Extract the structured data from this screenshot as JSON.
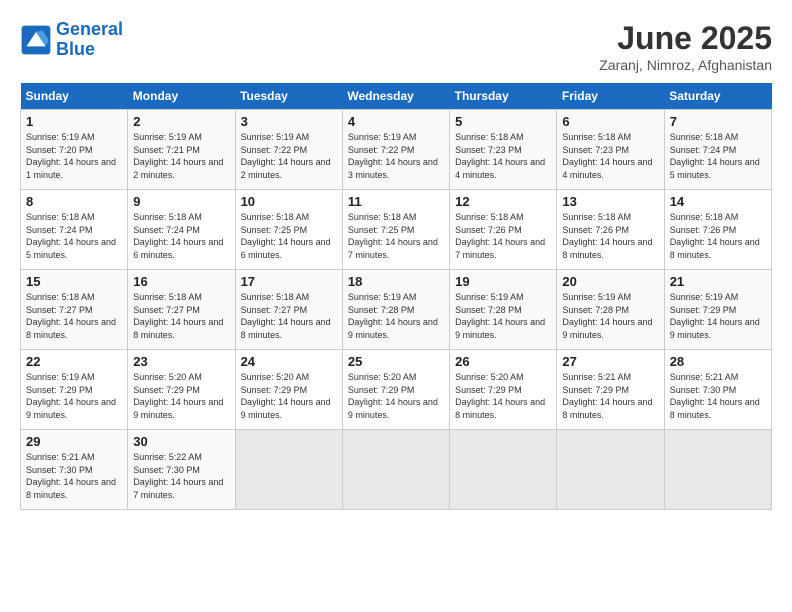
{
  "header": {
    "logo_line1": "General",
    "logo_line2": "Blue",
    "month": "June 2025",
    "location": "Zaranj, Nimroz, Afghanistan"
  },
  "weekdays": [
    "Sunday",
    "Monday",
    "Tuesday",
    "Wednesday",
    "Thursday",
    "Friday",
    "Saturday"
  ],
  "weeks": [
    [
      {
        "day": 1,
        "sunrise": "5:19 AM",
        "sunset": "7:20 PM",
        "daylight": "14 hours and 1 minute."
      },
      {
        "day": 2,
        "sunrise": "5:19 AM",
        "sunset": "7:21 PM",
        "daylight": "14 hours and 2 minutes."
      },
      {
        "day": 3,
        "sunrise": "5:19 AM",
        "sunset": "7:22 PM",
        "daylight": "14 hours and 2 minutes."
      },
      {
        "day": 4,
        "sunrise": "5:19 AM",
        "sunset": "7:22 PM",
        "daylight": "14 hours and 3 minutes."
      },
      {
        "day": 5,
        "sunrise": "5:18 AM",
        "sunset": "7:23 PM",
        "daylight": "14 hours and 4 minutes."
      },
      {
        "day": 6,
        "sunrise": "5:18 AM",
        "sunset": "7:23 PM",
        "daylight": "14 hours and 4 minutes."
      },
      {
        "day": 7,
        "sunrise": "5:18 AM",
        "sunset": "7:24 PM",
        "daylight": "14 hours and 5 minutes."
      }
    ],
    [
      {
        "day": 8,
        "sunrise": "5:18 AM",
        "sunset": "7:24 PM",
        "daylight": "14 hours and 5 minutes."
      },
      {
        "day": 9,
        "sunrise": "5:18 AM",
        "sunset": "7:24 PM",
        "daylight": "14 hours and 6 minutes."
      },
      {
        "day": 10,
        "sunrise": "5:18 AM",
        "sunset": "7:25 PM",
        "daylight": "14 hours and 6 minutes."
      },
      {
        "day": 11,
        "sunrise": "5:18 AM",
        "sunset": "7:25 PM",
        "daylight": "14 hours and 7 minutes."
      },
      {
        "day": 12,
        "sunrise": "5:18 AM",
        "sunset": "7:26 PM",
        "daylight": "14 hours and 7 minutes."
      },
      {
        "day": 13,
        "sunrise": "5:18 AM",
        "sunset": "7:26 PM",
        "daylight": "14 hours and 8 minutes."
      },
      {
        "day": 14,
        "sunrise": "5:18 AM",
        "sunset": "7:26 PM",
        "daylight": "14 hours and 8 minutes."
      }
    ],
    [
      {
        "day": 15,
        "sunrise": "5:18 AM",
        "sunset": "7:27 PM",
        "daylight": "14 hours and 8 minutes."
      },
      {
        "day": 16,
        "sunrise": "5:18 AM",
        "sunset": "7:27 PM",
        "daylight": "14 hours and 8 minutes."
      },
      {
        "day": 17,
        "sunrise": "5:18 AM",
        "sunset": "7:27 PM",
        "daylight": "14 hours and 8 minutes."
      },
      {
        "day": 18,
        "sunrise": "5:19 AM",
        "sunset": "7:28 PM",
        "daylight": "14 hours and 9 minutes."
      },
      {
        "day": 19,
        "sunrise": "5:19 AM",
        "sunset": "7:28 PM",
        "daylight": "14 hours and 9 minutes."
      },
      {
        "day": 20,
        "sunrise": "5:19 AM",
        "sunset": "7:28 PM",
        "daylight": "14 hours and 9 minutes."
      },
      {
        "day": 21,
        "sunrise": "5:19 AM",
        "sunset": "7:29 PM",
        "daylight": "14 hours and 9 minutes."
      }
    ],
    [
      {
        "day": 22,
        "sunrise": "5:19 AM",
        "sunset": "7:29 PM",
        "daylight": "14 hours and 9 minutes."
      },
      {
        "day": 23,
        "sunrise": "5:20 AM",
        "sunset": "7:29 PM",
        "daylight": "14 hours and 9 minutes."
      },
      {
        "day": 24,
        "sunrise": "5:20 AM",
        "sunset": "7:29 PM",
        "daylight": "14 hours and 9 minutes."
      },
      {
        "day": 25,
        "sunrise": "5:20 AM",
        "sunset": "7:29 PM",
        "daylight": "14 hours and 9 minutes."
      },
      {
        "day": 26,
        "sunrise": "5:20 AM",
        "sunset": "7:29 PM",
        "daylight": "14 hours and 8 minutes."
      },
      {
        "day": 27,
        "sunrise": "5:21 AM",
        "sunset": "7:29 PM",
        "daylight": "14 hours and 8 minutes."
      },
      {
        "day": 28,
        "sunrise": "5:21 AM",
        "sunset": "7:30 PM",
        "daylight": "14 hours and 8 minutes."
      }
    ],
    [
      {
        "day": 29,
        "sunrise": "5:21 AM",
        "sunset": "7:30 PM",
        "daylight": "14 hours and 8 minutes."
      },
      {
        "day": 30,
        "sunrise": "5:22 AM",
        "sunset": "7:30 PM",
        "daylight": "14 hours and 7 minutes."
      },
      null,
      null,
      null,
      null,
      null
    ]
  ]
}
